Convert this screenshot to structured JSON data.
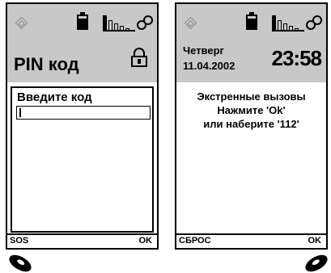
{
  "pin_screen": {
    "status_icons": [
      "signal-diamond-icon",
      "battery-icon",
      "signal-strength-icon",
      "network-icon"
    ],
    "title": "PIN код",
    "lock_icon": "lock-icon",
    "prompt": "Введите код",
    "input_value": "",
    "softkey_left": "SOS",
    "softkey_right": "OK",
    "handset_icon": "end-call-handset-icon"
  },
  "idle_screen": {
    "status_icons": [
      "signal-diamond-icon",
      "battery-icon",
      "signal-strength-icon",
      "network-icon"
    ],
    "day": "Четверг",
    "date": "11.04.2002",
    "time": "23:58",
    "lines": [
      "Экстренные вызовы",
      "Нажмите 'Ok'",
      "или наберите '112'"
    ],
    "softkey_left": "СБРОС",
    "softkey_right": "OK",
    "handset_icon": "call-handset-icon"
  },
  "colors": {
    "header_bg": "#c8c8c8",
    "screen_bg": "#ffffff",
    "text": "#000000",
    "diamond_icon": "#8a8a8a"
  }
}
